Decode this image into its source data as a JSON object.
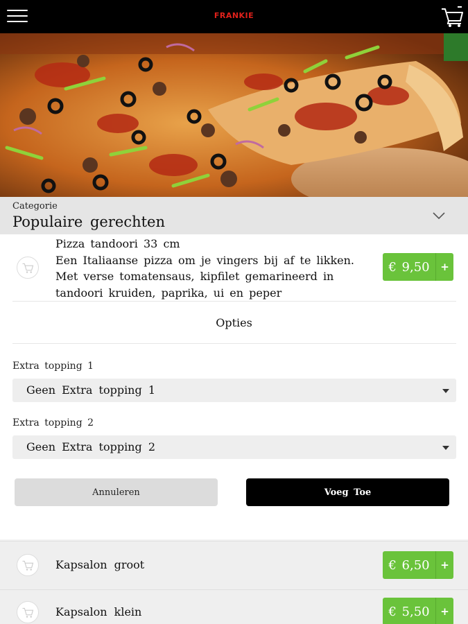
{
  "header": {
    "brand": "FRANKIE",
    "menu_icon": "hamburger-menu-icon",
    "cart_icon": "shopping-cart-icon"
  },
  "hero": {
    "image": "pizza-photo"
  },
  "category": {
    "label": "Categorie",
    "value": "Populaire gerechten",
    "chevron_icon": "chevron-down-icon"
  },
  "selected_product": {
    "name": "Pizza tandoori 33 cm",
    "description_lines": [
      "Een Italiaanse pizza om je vingers bij af te likken.",
      "Met verse tomatensaus, kipfilet gemarineerd in",
      "tandoori kruiden, paprika, ui en peper"
    ],
    "price": "€ 9,50",
    "add_label": "+"
  },
  "options": {
    "title": "Opties",
    "fields": [
      {
        "label": "Extra topping 1",
        "value": "Geen Extra topping 1"
      },
      {
        "label": "Extra topping 2",
        "value": "Geen Extra topping 2"
      }
    ],
    "cancel_label": "Annuleren",
    "add_label": "Voeg Toe"
  },
  "products": [
    {
      "name": "Kapsalon groot",
      "price": "€ 6,50",
      "add_label": "+"
    },
    {
      "name": "Kapsalon klein",
      "price": "€ 5,50",
      "add_label": "+"
    }
  ],
  "colors": {
    "accent_green": "#6ac33b",
    "brand_red": "#e0211b",
    "topbar": "#000000"
  }
}
